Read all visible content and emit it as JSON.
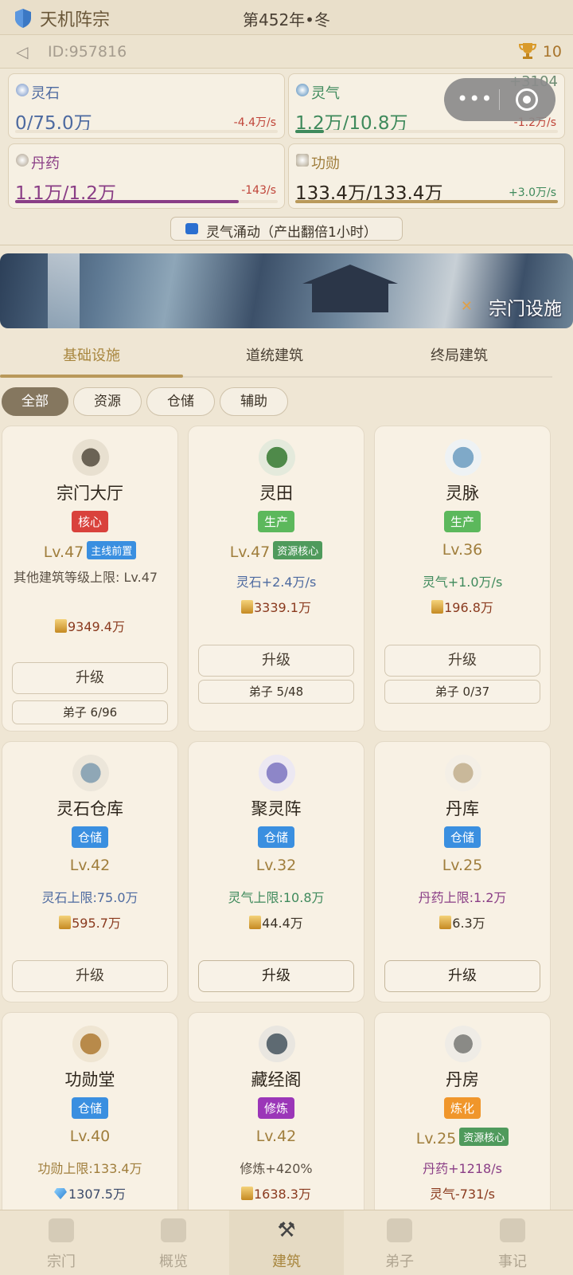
{
  "header": {
    "sect_name": "天机阵宗",
    "year": "第452年•冬"
  },
  "subbar": {
    "back_glyph": "◁",
    "user_id": "ID:957816",
    "trophy_count": "10"
  },
  "resources": {
    "float_gain": "+3104",
    "items": [
      {
        "name": "灵石",
        "value": "0/75.0万",
        "rate": "-4.4万/s",
        "fill": 0.0
      },
      {
        "name": "灵气",
        "value": "1.2万/10.8万",
        "rate": "-1.2万/s",
        "fill": 0.11
      },
      {
        "name": "丹药",
        "value": "1.1万/1.2万",
        "rate": "-143/s",
        "fill": 0.85
      },
      {
        "name": "功勋",
        "value": "133.4万/133.4万",
        "rate": "+3.0万/s",
        "fill": 1.0
      }
    ],
    "boost_label": "灵气涌动（产出翻倍1小时）"
  },
  "capsule": {
    "more_glyph": "•••"
  },
  "banner": {
    "title": "宗门设施"
  },
  "tabs": [
    "基础设施",
    "道统建筑",
    "终局建筑"
  ],
  "chips": [
    "全部",
    "资源",
    "仓储",
    "辅助"
  ],
  "cards": [
    {
      "title": "宗门大厅",
      "tag": "核心",
      "level": "Lv.47",
      "sub_tag": "主线前置",
      "desc": "其他建筑等级上限: Lv.47",
      "cost": "9349.4万",
      "button": "升级",
      "disciples": "弟子 6/96"
    },
    {
      "title": "灵田",
      "tag": "生产",
      "level": "Lv.47",
      "sub_tag": "资源核心",
      "effect": "灵石+2.4万/s",
      "cost": "3339.1万",
      "button": "升级",
      "disciples": "弟子 5/48"
    },
    {
      "title": "灵脉",
      "tag": "生产",
      "level": "Lv.36",
      "effect": "灵气+1.0万/s",
      "cost": "196.8万",
      "button": "升级",
      "disciples": "弟子 0/37"
    },
    {
      "title": "灵石仓库",
      "tag": "仓储",
      "level": "Lv.42",
      "effect": "灵石上限:75.0万",
      "cost": "595.7万",
      "button": "升级"
    },
    {
      "title": "聚灵阵",
      "tag": "仓储",
      "level": "Lv.32",
      "effect": "灵气上限:10.8万",
      "cost": "44.4万",
      "button": "升级"
    },
    {
      "title": "丹库",
      "tag": "仓储",
      "level": "Lv.25",
      "effect": "丹药上限:1.2万",
      "cost": "6.3万",
      "button": "升级"
    },
    {
      "title": "功勋堂",
      "tag": "仓储",
      "level": "Lv.40",
      "effect": "功勋上限:133.4万",
      "cost": "1307.5万"
    },
    {
      "title": "藏经阁",
      "tag": "修炼",
      "level": "Lv.42",
      "effect": "修炼+420%",
      "cost": "1638.3万"
    },
    {
      "title": "丹房",
      "tag": "炼化",
      "level": "Lv.25",
      "sub_tag": "资源核心",
      "effect": "丹药+1218/s",
      "effect2": "灵气-731/s"
    }
  ],
  "bottom_nav": [
    "宗门",
    "概览",
    "建筑",
    "弟子",
    "事记"
  ],
  "colors": {
    "accent": "#a8863e",
    "tag_core": "#d9423c",
    "tag_produce": "#5cb85c",
    "tag_storage": "#3a8fe0",
    "tag_cultivate": "#9b36b8",
    "tag_refine": "#f0962b"
  }
}
